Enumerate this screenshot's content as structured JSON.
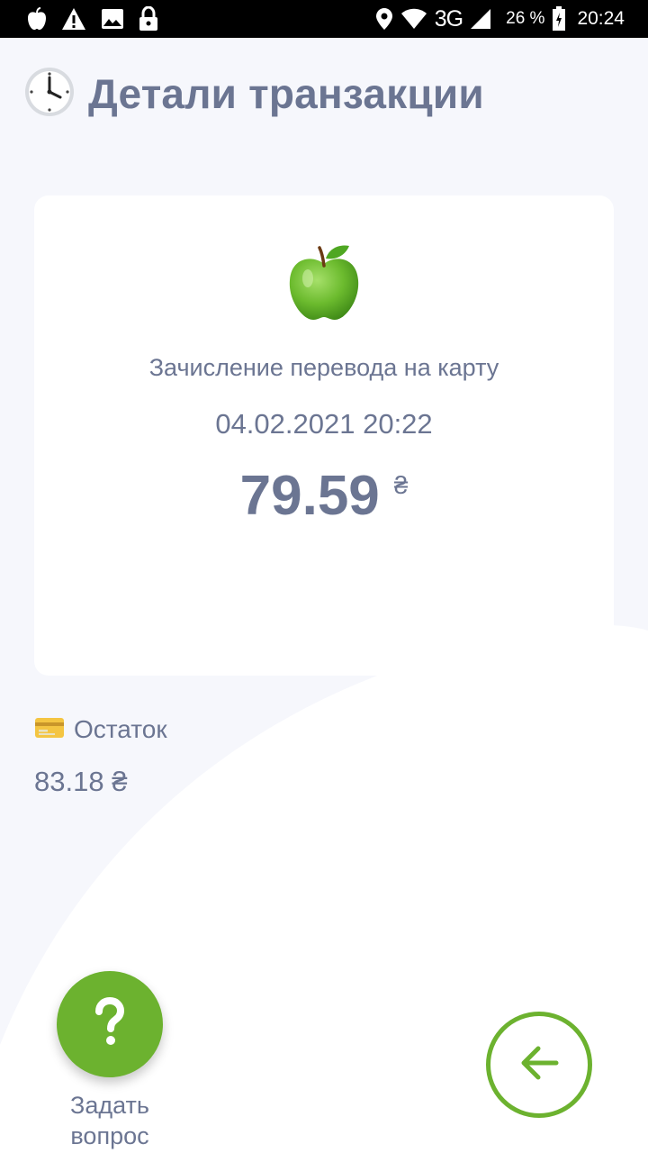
{
  "status_bar": {
    "network": "3G",
    "battery": "26 %",
    "time": "20:24",
    "icons_left": [
      "apple-icon",
      "warning-icon",
      "image-icon",
      "lock-icon"
    ],
    "icons_right": [
      "location-icon",
      "wifi-icon",
      "signal-icon",
      "battery-icon"
    ]
  },
  "header": {
    "icon": "clock-icon",
    "title": "Детали транзакции"
  },
  "transaction": {
    "icon": "green-apple-icon",
    "description": "Зачисление перевода на карту",
    "datetime": "04.02.2021 20:22",
    "amount": "79.59",
    "currency": "₴"
  },
  "balance": {
    "icon": "credit-card-icon",
    "label": "Остаток",
    "value": "83.18 ₴"
  },
  "actions": {
    "help_label": "Задать вопрос",
    "help_icon": "question-mark-icon",
    "back_icon": "arrow-left-icon"
  },
  "colors": {
    "background": "#f6f7fc",
    "card": "#ffffff",
    "text": "#6b7592",
    "accent": "#6cb22f"
  }
}
